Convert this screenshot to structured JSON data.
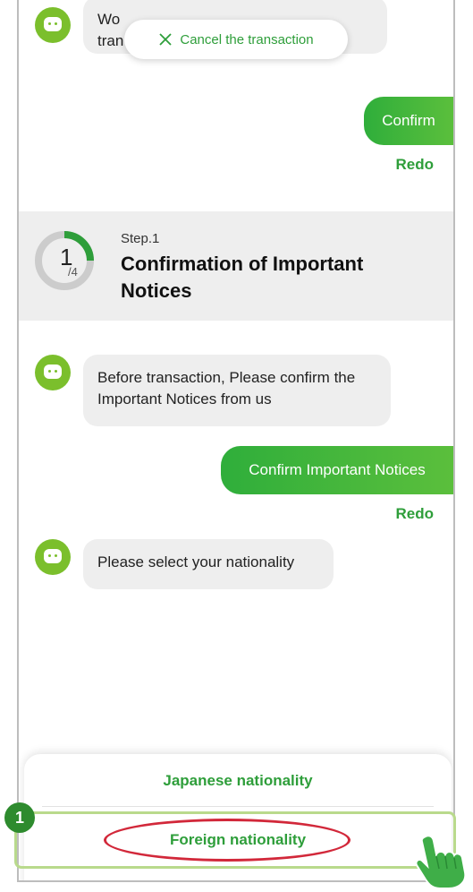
{
  "chat": {
    "top_bubble_text": "Wo",
    "top_bubble_text_2": "tran",
    "confirm_label": "Confirm",
    "redo_1": "Redo",
    "msg_before": "Before transaction, Please confirm the Important Notices from us",
    "confirm_notices_label": "Confirm Important Notices",
    "redo_2": "Redo",
    "msg_nationality": "Please select your nationality"
  },
  "cancel": {
    "label": "Cancel the transaction",
    "icon": "close-icon"
  },
  "step": {
    "label": "Step.1",
    "title": "Confirmation of Important Notices",
    "current": "1",
    "total": "/4",
    "progress": 0.25
  },
  "options": {
    "japanese": "Japanese nationality",
    "foreign": "Foreign nationality"
  },
  "annotation": {
    "badge": "1"
  },
  "colors": {
    "accent": "#2e9e3a",
    "bubble_gradient_start": "#2fae3b",
    "bubble_gradient_end": "#5bbf3c",
    "highlight_red": "#d2283a",
    "highlight_green": "#b9da8c"
  }
}
